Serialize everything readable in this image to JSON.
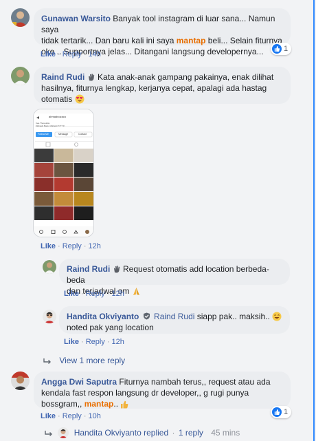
{
  "colors": {
    "link": "#385898",
    "action_link": "#4267b2",
    "keyword": "#e86e00",
    "bubble": "#ebedf0",
    "background": "#f2f3f5",
    "like": "#1877f2"
  },
  "comments": [
    {
      "author": "Gunawan Warsito",
      "text_1": "Banyak tool instagram di luar sana... Namun saya",
      "text_2_a": "tidak tertarik... Dan baru kali ini saya ",
      "keyword": "mantap",
      "text_2_b": " beli... Selain fiturnya",
      "text_3": "oke .. Supportnya jelas... Ditangani langsung developernya...",
      "like": "Like",
      "reply": "Reply",
      "time": "14h",
      "reactions": "1",
      "icons": [
        "like-icon"
      ]
    },
    {
      "author": "Raind Rudi",
      "text_1": "Kata anak-anak gampang pakainya, enak dilihat",
      "text_2": "hasilnya, fiturnya lengkap, kerjanya cepat, apalagi ada hastag",
      "text_3": "otomatis",
      "like": "Like",
      "reply": "Reply",
      "time": "12h",
      "icons": [
        "waving-hand-icon",
        "heart-eyes-emoji-icon"
      ],
      "attachment": {
        "profile_name": "ahmadnozaco",
        "bio_1": "Kea Thereuktie",
        "bio_2": "Mahasiti Bauk, Mahasiti 777 7#",
        "buttons": [
          "Follow Me",
          "Message",
          "Contact"
        ]
      }
    },
    {
      "author": "Raind Rudi",
      "text_1": "Request otomatis add location berbeda-beda",
      "text_2": "dan terjadwal om",
      "like": "Like",
      "reply": "Reply",
      "time": "12h",
      "icons": [
        "waving-hand-icon",
        "praying-hands-emoji-icon"
      ]
    },
    {
      "author": "Handita Okviyanto",
      "mention": "Raind Rudi",
      "text_1": "siapp pak.. maksih..",
      "text_2": "noted pak yang location",
      "like": "Like",
      "reply": "Reply",
      "time": "12h",
      "icons": [
        "verified-shield-icon",
        "grinning-emoji-icon"
      ]
    },
    {
      "view_more": "View 1 more reply",
      "icons": [
        "reply-arrow-icon"
      ]
    },
    {
      "author": "Angga Dwi Saputra",
      "text_1": "Fiturnya nambah terus,, request atau ada",
      "text_2": "kendala fast respon langsung dr developer,, g rugi punya",
      "text_3_a": "bossgram,, ",
      "keyword": "mantap",
      "text_3_b": "..",
      "like": "Like",
      "reply": "Reply",
      "time": "10h",
      "reactions": "1",
      "icons": [
        "thumbs-up-emoji-icon",
        "like-icon"
      ]
    },
    {
      "replied_author": "Handita Okviyanto",
      "replied_word": "replied",
      "reply_count": "1 reply",
      "time": "45 mins",
      "icons": [
        "reply-arrow-icon"
      ]
    }
  ]
}
